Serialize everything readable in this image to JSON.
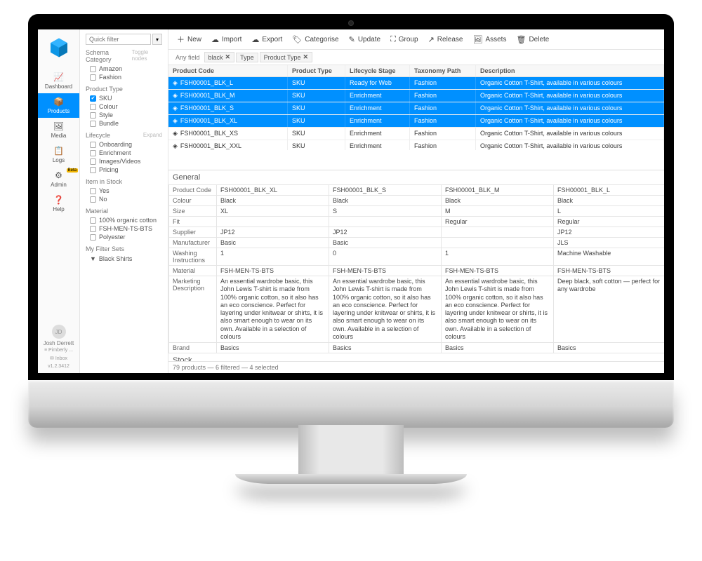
{
  "sidebar": {
    "items": [
      {
        "icon": "speed-icon",
        "label": "Dashboard"
      },
      {
        "icon": "cube-icon",
        "label": "Products"
      },
      {
        "icon": "image-icon",
        "label": "Media"
      },
      {
        "icon": "log-icon",
        "label": "Logs"
      },
      {
        "icon": "gear-icon",
        "label": "Admin",
        "badge": "Beta"
      },
      {
        "icon": "help-icon",
        "label": "Help"
      }
    ],
    "user": {
      "initials": "JD",
      "name": "Josh Derrett",
      "org": "Pimberly ...",
      "inbox": "Inbox",
      "version": "v1.2.3412"
    }
  },
  "filters": {
    "quick_placeholder": "Quick filter",
    "groups": [
      {
        "title": "Schema Category",
        "toggle": "Toggle nodes",
        "items": [
          {
            "label": "Amazon",
            "checked": false
          },
          {
            "label": "Fashion",
            "checked": false
          }
        ]
      },
      {
        "title": "Product Type",
        "items": [
          {
            "label": "SKU",
            "checked": true
          },
          {
            "label": "Colour",
            "checked": false
          },
          {
            "label": "Style",
            "checked": false
          },
          {
            "label": "Bundle",
            "checked": false
          }
        ]
      },
      {
        "title": "Lifecycle",
        "toggle": "Expand",
        "items": [
          {
            "label": "Onboarding",
            "checked": false
          },
          {
            "label": "Enrichment",
            "checked": false
          },
          {
            "label": "Images/Videos",
            "checked": false
          },
          {
            "label": "Pricing",
            "checked": false
          }
        ]
      },
      {
        "title": "Item in Stock",
        "items": [
          {
            "label": "Yes",
            "checked": false
          },
          {
            "label": "No",
            "checked": false
          }
        ]
      },
      {
        "title": "Material",
        "items": [
          {
            "label": "100% organic cotton",
            "checked": false
          },
          {
            "label": "FSH-MEN-TS-BTS",
            "checked": false
          },
          {
            "label": "Polyester",
            "checked": false
          }
        ]
      }
    ],
    "saved_title": "My Filter Sets",
    "saved": [
      {
        "label": "Black Shirts"
      }
    ]
  },
  "toolbar": [
    {
      "icon": "plus-icon",
      "label": "New"
    },
    {
      "icon": "cloud-down-icon",
      "label": "Import"
    },
    {
      "icon": "cloud-up-icon",
      "label": "Export"
    },
    {
      "icon": "tag-icon",
      "label": "Categorise"
    },
    {
      "icon": "pencil-icon",
      "label": "Update"
    },
    {
      "icon": "group-icon",
      "label": "Group"
    },
    {
      "icon": "release-icon",
      "label": "Release"
    },
    {
      "icon": "assets-icon",
      "label": "Assets"
    },
    {
      "icon": "trash-icon",
      "label": "Delete"
    }
  ],
  "chips": {
    "any_field": "Any field",
    "items": [
      {
        "label": "black",
        "close": true
      },
      {
        "label": "Type",
        "close": false
      },
      {
        "label": "Product Type",
        "close": true
      }
    ]
  },
  "grid": {
    "columns": [
      "Product Code",
      "Product Type",
      "Lifecycle Stage",
      "Taxonomy Path",
      "Description"
    ],
    "rows": [
      {
        "sel": true,
        "code": "FSH00001_BLK_L",
        "type": "SKU",
        "stage": "Ready for Web",
        "path": "Fashion",
        "desc": "Organic Cotton T-Shirt, available in various colours"
      },
      {
        "sel": true,
        "code": "FSH00001_BLK_M",
        "type": "SKU",
        "stage": "Enrichment",
        "path": "Fashion",
        "desc": "Organic Cotton T-Shirt, available in various colours"
      },
      {
        "sel": true,
        "code": "FSH00001_BLK_S",
        "type": "SKU",
        "stage": "Enrichment",
        "path": "Fashion",
        "desc": "Organic Cotton T-Shirt, available in various colours"
      },
      {
        "sel": true,
        "code": "FSH00001_BLK_XL",
        "type": "SKU",
        "stage": "Enrichment",
        "path": "Fashion",
        "desc": "Organic Cotton T-Shirt, available in various colours"
      },
      {
        "sel": false,
        "code": "FSH00001_BLK_XS",
        "type": "SKU",
        "stage": "Enrichment",
        "path": "Fashion",
        "desc": "Organic Cotton T-Shirt, available in various colours"
      },
      {
        "sel": false,
        "code": "FSH00001_BLK_XXL",
        "type": "SKU",
        "stage": "Enrichment",
        "path": "Fashion",
        "desc": "Organic Cotton T-Shirt, available in various colours"
      }
    ]
  },
  "detail": {
    "section": "General",
    "rows": [
      {
        "label": "Product Code",
        "v": [
          "FSH00001_BLK_XL",
          "FSH00001_BLK_S",
          "FSH00001_BLK_M",
          "FSH00001_BLK_L"
        ]
      },
      {
        "label": "Colour",
        "v": [
          "Black",
          "Black",
          "Black",
          "Black"
        ]
      },
      {
        "label": "Size",
        "v": [
          "XL",
          "S",
          "M",
          "L"
        ]
      },
      {
        "label": "Fit",
        "v": [
          "",
          "",
          "Regular",
          "Regular"
        ]
      },
      {
        "label": "Supplier",
        "v": [
          "JP12",
          "JP12",
          "",
          "JP12"
        ]
      },
      {
        "label": "Manufacturer",
        "v": [
          "Basic",
          "Basic",
          "",
          "JLS"
        ]
      },
      {
        "label": "Washing Instructions",
        "v": [
          "1",
          "0",
          "1",
          "Machine Washable"
        ]
      },
      {
        "label": "Material",
        "v": [
          "FSH-MEN-TS-BTS",
          "FSH-MEN-TS-BTS",
          "FSH-MEN-TS-BTS",
          "FSH-MEN-TS-BTS"
        ]
      },
      {
        "label": "Marketing Description",
        "v": [
          "An essential wardrobe basic, this John Lewis T-shirt is made from 100% organic cotton, so it also has an eco conscience. Perfect for layering under knitwear or shirts, it is also smart enough to wear on its own. Available in a selection of colours",
          "An essential wardrobe basic, this John Lewis T-shirt is made from 100% organic cotton, so it also has an eco conscience. Perfect for layering under knitwear or shirts, it is also smart enough to wear on its own. Available in a selection of colours",
          "An essential wardrobe basic, this John Lewis T-shirt is made from 100% organic cotton, so it also has an eco conscience. Perfect for layering under knitwear or shirts, it is also smart enough to wear on its own. Available in a selection of colours",
          "Deep black, soft cotton — perfect for any wardrobe"
        ]
      },
      {
        "label": "Brand",
        "v": [
          "Basics",
          "Basics",
          "Basics",
          "Basics"
        ]
      }
    ],
    "stock_section": "Stock"
  },
  "status": "79 products — 6 filtered — 4 selected",
  "icons": {
    "speed-icon": "📈",
    "cube-icon": "📦",
    "image-icon": "🖼",
    "log-icon": "📋",
    "gear-icon": "⚙",
    "help-icon": "❓",
    "plus-icon": "＋",
    "cloud-down-icon": "☁",
    "cloud-up-icon": "☁",
    "tag-icon": "🏷",
    "pencil-icon": "✎",
    "group-icon": "⛶",
    "release-icon": "↗",
    "assets-icon": "🖼",
    "trash-icon": "🗑",
    "funnel-icon": "▼",
    "row-icon": "◈",
    "chevron-down-icon": "▾",
    "envelope-icon": "✉",
    "list-icon": "≡"
  }
}
